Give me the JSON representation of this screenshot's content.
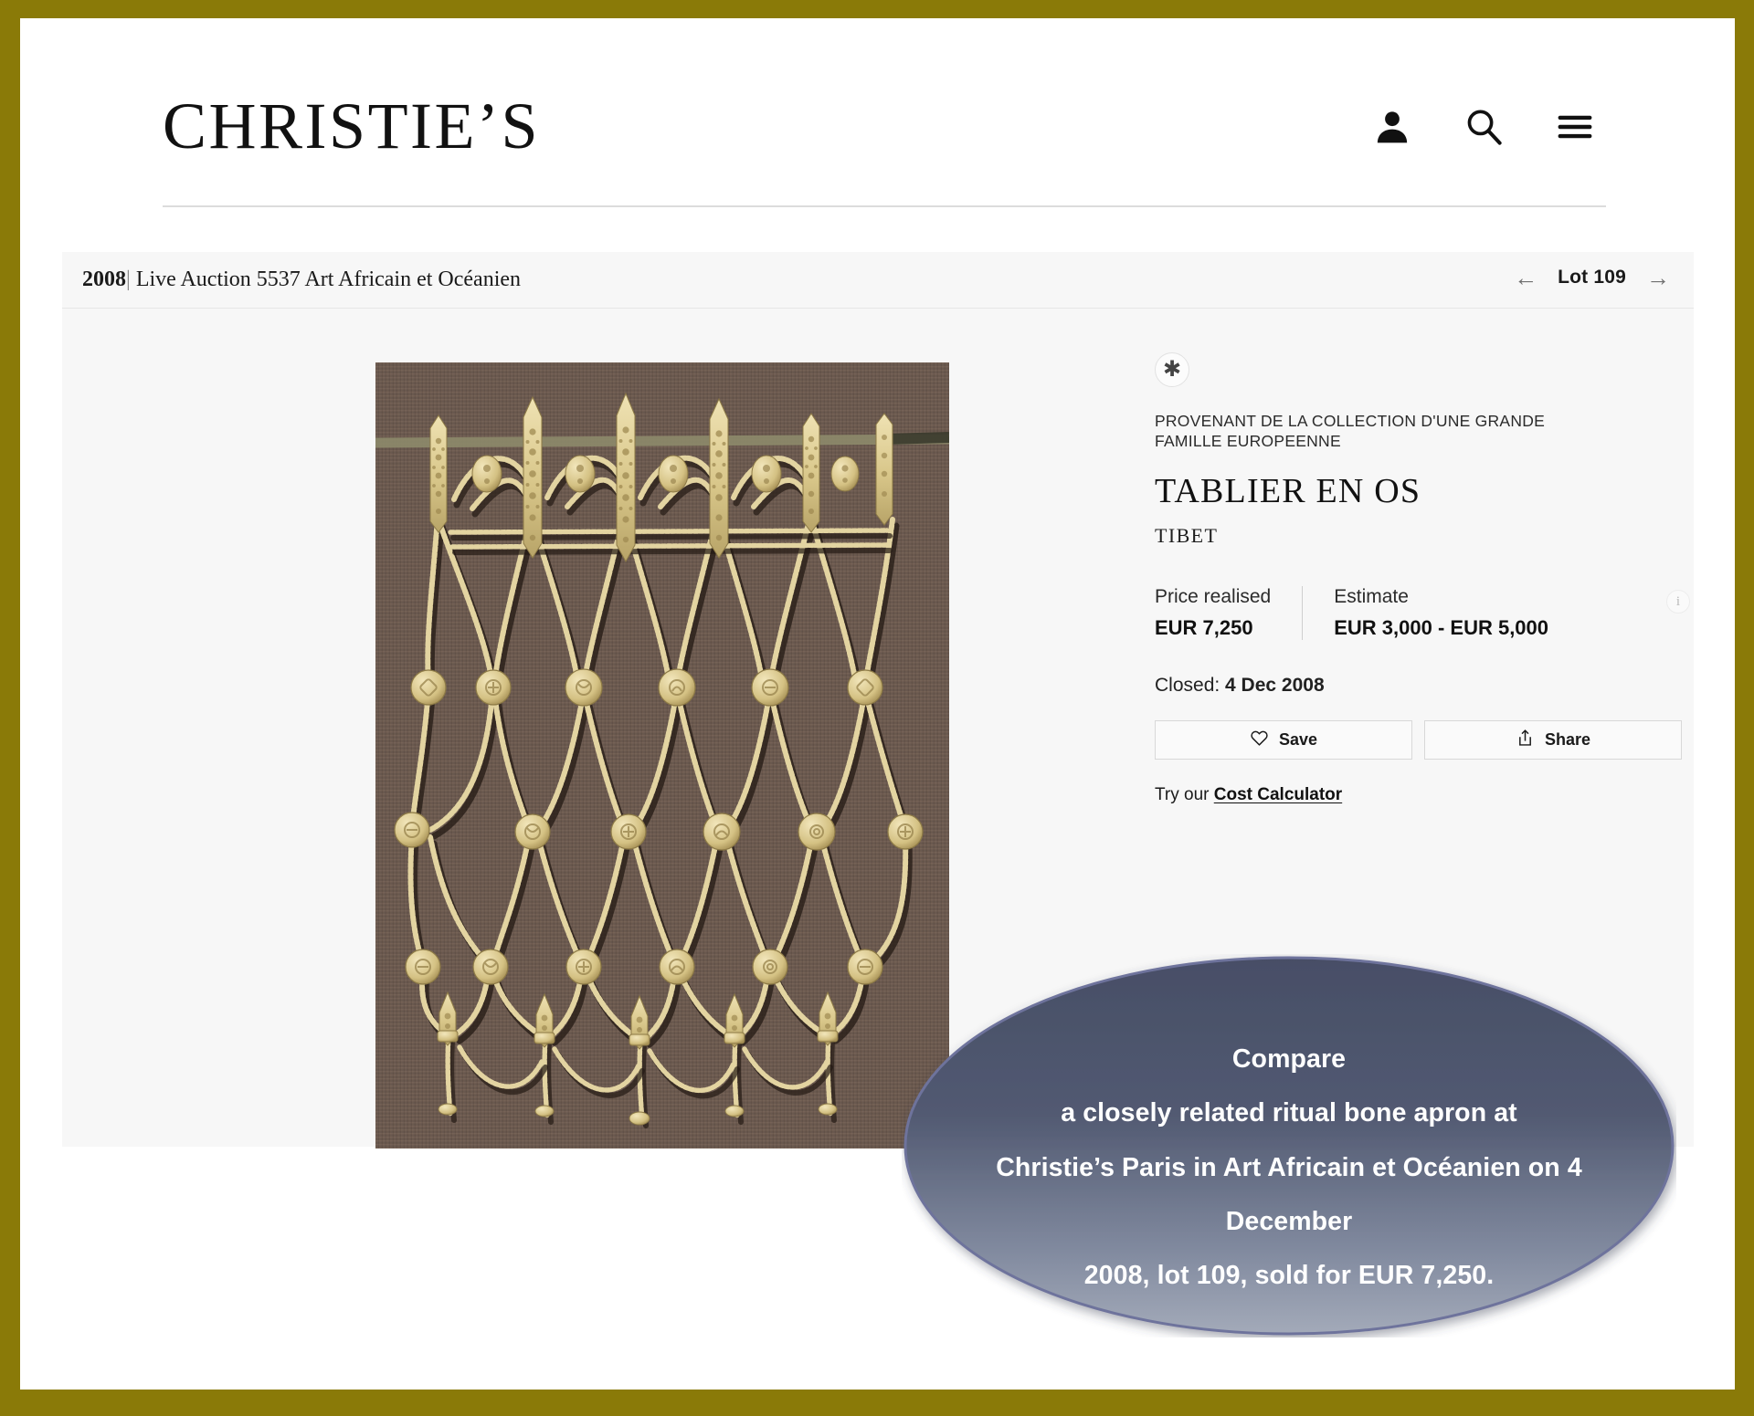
{
  "brand": {
    "logo": "CHRISTIE’S"
  },
  "header": {
    "icons": [
      {
        "name": "account-icon",
        "label": "Account"
      },
      {
        "name": "search-icon",
        "label": "Search"
      },
      {
        "name": "menu-icon",
        "label": "Menu"
      }
    ]
  },
  "breadcrumb": {
    "year": "2008",
    "separator": "|",
    "auction": "Live Auction 5537 Art Africain et Océanien"
  },
  "lot_nav": {
    "prev_arrow": "←",
    "label": "Lot 109",
    "next_arrow": "→"
  },
  "lot": {
    "badge": "✱",
    "provenance": "PROVENANT DE LA COLLECTION D'UNE GRANDE FAMILLE EUROPEENNE",
    "title": "TABLIER EN OS",
    "origin": "TIBET",
    "price_realised_label": "Price realised",
    "price_realised_value": "EUR 7,250",
    "estimate_label": "Estimate",
    "estimate_value": "EUR 3,000 - EUR 5,000",
    "info_icon": "i",
    "status_label": "Closed:",
    "status_date": "4 Dec 2008"
  },
  "actions": {
    "save_label": "Save",
    "share_label": "Share",
    "cost_prefix": "Try our",
    "cost_link": "Cost Calculator"
  },
  "callout": {
    "line1": "Compare",
    "line2": "a closely related ritual bone apron at",
    "line3": "Christie’s Paris in Art Africain et Océanien on 4 December",
    "line4": "2008, lot 109, sold for EUR 7,250."
  },
  "artwork": {
    "alt": "Tibetan carved bone ritual apron with beaded netting and medallions",
    "background": "#6c5b50",
    "bone_color": "#d9c88c"
  },
  "colors": {
    "slide_border": "#8a7a08",
    "panel_bg": "#f7f7f7",
    "callout_top": "#4a5168",
    "callout_bottom": "#9aa2b4",
    "callout_border": "#6a6f9a"
  }
}
